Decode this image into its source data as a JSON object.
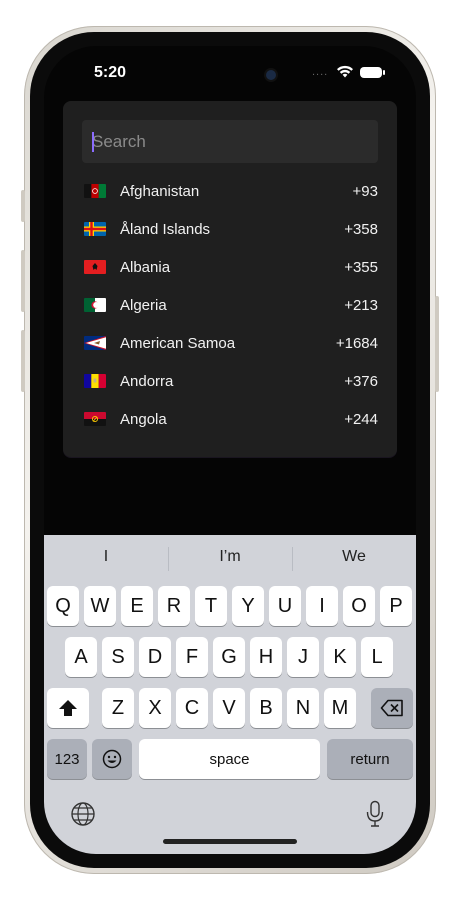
{
  "status_bar": {
    "time": "5:20",
    "signal": "...."
  },
  "search": {
    "placeholder": "Search",
    "value": ""
  },
  "countries": [
    {
      "name": "Afghanistan",
      "code": "+93",
      "flag": "af-flag-icon"
    },
    {
      "name": "Åland Islands",
      "code": "+358",
      "flag": "ax-flag-icon"
    },
    {
      "name": "Albania",
      "code": "+355",
      "flag": "al-flag-icon"
    },
    {
      "name": "Algeria",
      "code": "+213",
      "flag": "dz-flag-icon"
    },
    {
      "name": "American Samoa",
      "code": "+1684",
      "flag": "as-flag-icon"
    },
    {
      "name": "Andorra",
      "code": "+376",
      "flag": "ad-flag-icon"
    },
    {
      "name": "Angola",
      "code": "+244",
      "flag": "ao-flag-icon"
    }
  ],
  "keyboard": {
    "suggestions": [
      "I",
      "I’m",
      "We"
    ],
    "row1": [
      "Q",
      "W",
      "E",
      "R",
      "T",
      "Y",
      "U",
      "I",
      "O",
      "P"
    ],
    "row2": [
      "A",
      "S",
      "D",
      "F",
      "G",
      "H",
      "J",
      "K",
      "L"
    ],
    "row3": [
      "Z",
      "X",
      "C",
      "V",
      "B",
      "N",
      "M"
    ],
    "numbers_key": "123",
    "space_key": "space",
    "return_key": "return",
    "icons": [
      "shift-icon",
      "backspace-icon",
      "emoji-icon",
      "globe-icon",
      "microphone-icon"
    ]
  },
  "colors": {
    "panel": "#1f1f1f",
    "search_bg": "#2b2b2b",
    "caret": "#8b6cff",
    "keyboard_bg": "#d1d3d9"
  }
}
